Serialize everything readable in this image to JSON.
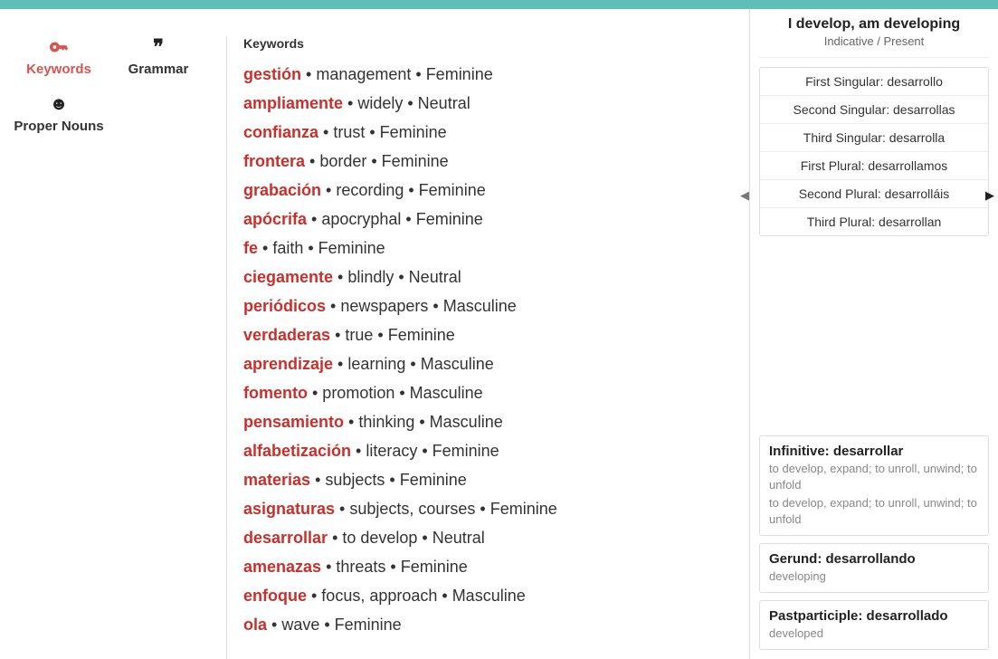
{
  "nav": {
    "keywords": "Keywords",
    "grammar": "Grammar",
    "proper_nouns": "Proper Nouns"
  },
  "content": {
    "title": "Keywords",
    "separator": " • ",
    "keywords": [
      {
        "word": "gestión",
        "translation": "management",
        "gender": "Feminine"
      },
      {
        "word": "ampliamente",
        "translation": "widely",
        "gender": "Neutral"
      },
      {
        "word": "confianza",
        "translation": "trust",
        "gender": "Feminine"
      },
      {
        "word": "frontera",
        "translation": "border",
        "gender": "Feminine"
      },
      {
        "word": "grabación",
        "translation": "recording",
        "gender": "Feminine"
      },
      {
        "word": "apócrifa",
        "translation": "apocryphal",
        "gender": "Feminine"
      },
      {
        "word": "fe",
        "translation": "faith",
        "gender": "Feminine"
      },
      {
        "word": "ciegamente",
        "translation": "blindly",
        "gender": "Neutral"
      },
      {
        "word": "periódicos",
        "translation": "newspapers",
        "gender": "Masculine"
      },
      {
        "word": "verdaderas",
        "translation": "true",
        "gender": "Feminine"
      },
      {
        "word": "aprendizaje",
        "translation": "learning",
        "gender": "Masculine"
      },
      {
        "word": "fomento",
        "translation": "promotion",
        "gender": "Masculine"
      },
      {
        "word": "pensamiento",
        "translation": "thinking",
        "gender": "Masculine"
      },
      {
        "word": "alfabetización",
        "translation": "literacy",
        "gender": "Feminine"
      },
      {
        "word": "materias",
        "translation": "subjects",
        "gender": "Feminine"
      },
      {
        "word": "asignaturas",
        "translation": "subjects, courses",
        "gender": "Feminine"
      },
      {
        "word": "desarrollar",
        "translation": "to develop",
        "gender": "Neutral"
      },
      {
        "word": "amenazas",
        "translation": "threats",
        "gender": "Feminine"
      },
      {
        "word": "enfoque",
        "translation": "focus, approach",
        "gender": "Masculine"
      },
      {
        "word": "ola",
        "translation": "wave",
        "gender": "Feminine"
      }
    ]
  },
  "conjugation": {
    "title": "I develop, am developing",
    "subtitle": "Indicative / Present",
    "rows": [
      "First Singular: desarrollo",
      "Second Singular: desarrollas",
      "Third Singular: desarrolla",
      "First Plural: desarrollamos",
      "Second Plural: desarrolláis",
      "Third Plural: desarrollan"
    ],
    "infinitive": {
      "title": "Infinitive: desarrollar",
      "desc1": "to develop, expand; to unroll, unwind; to unfold",
      "desc2": "to develop, expand; to unroll, unwind; to unfold"
    },
    "gerund": {
      "title": "Gerund: desarrollando",
      "desc": "developing"
    },
    "pastparticiple": {
      "title": "Pastparticiple: desarrollado",
      "desc": "developed"
    }
  },
  "arrows": {
    "left": "◀",
    "right": "▶"
  }
}
